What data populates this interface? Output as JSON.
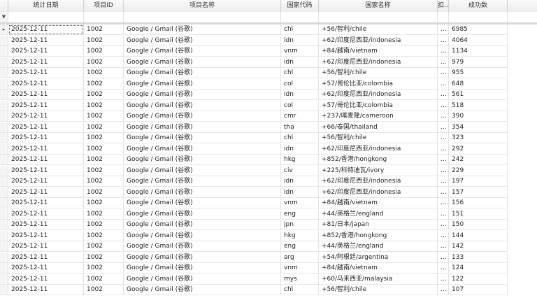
{
  "columns": [
    "统计日期",
    "项目ID",
    "项目名称",
    "国家代码",
    "国家名称",
    "扣…",
    "成功数"
  ],
  "filter_icon": "▼",
  "current_row_icon": "▸",
  "rows": [
    {
      "date": "2025-12-11",
      "pid": "1002",
      "pname": "Google / Gmail (谷歌)",
      "code": "chl",
      "country": "+56/智利/chile",
      "x": "...",
      "count": "6985"
    },
    {
      "date": "2025-12-11",
      "pid": "1002",
      "pname": "Google / Gmail (谷歌)",
      "code": "idn",
      "country": "+62/印度尼西亚/indonesia",
      "x": "...",
      "count": "4064"
    },
    {
      "date": "2025-12-11",
      "pid": "1002",
      "pname": "Google / Gmail (谷歌)",
      "code": "vnm",
      "country": "+84/越南/vietnam",
      "x": "...",
      "count": "1134"
    },
    {
      "date": "2025-12-11",
      "pid": "1002",
      "pname": "Google / Gmail (谷歌)",
      "code": "idn",
      "country": "+62/印度尼西亚/indonesia",
      "x": "...",
      "count": "979"
    },
    {
      "date": "2025-12-11",
      "pid": "1002",
      "pname": "Google / Gmail (谷歌)",
      "code": "chl",
      "country": "+56/智利/chile",
      "x": "...",
      "count": "955"
    },
    {
      "date": "2025-12-11",
      "pid": "1002",
      "pname": "Google / Gmail (谷歌)",
      "code": "col",
      "country": "+57/哥伦比亚/colombia",
      "x": "...",
      "count": "648"
    },
    {
      "date": "2025-12-11",
      "pid": "1002",
      "pname": "Google / Gmail (谷歌)",
      "code": "idn",
      "country": "+62/印度尼西亚/indonesia",
      "x": "...",
      "count": "561"
    },
    {
      "date": "2025-12-11",
      "pid": "1002",
      "pname": "Google / Gmail (谷歌)",
      "code": "col",
      "country": "+57/哥伦比亚/colombia",
      "x": "...",
      "count": "518"
    },
    {
      "date": "2025-12-11",
      "pid": "1002",
      "pname": "Google / Gmail (谷歌)",
      "code": "cmr",
      "country": "+237/喀麦隆/cameroon",
      "x": "...",
      "count": "390"
    },
    {
      "date": "2025-12-11",
      "pid": "1002",
      "pname": "Google / Gmail (谷歌)",
      "code": "tha",
      "country": "+66/泰国/thailand",
      "x": "...",
      "count": "354"
    },
    {
      "date": "2025-12-11",
      "pid": "1002",
      "pname": "Google / Gmail (谷歌)",
      "code": "chl",
      "country": "+56/智利/chile",
      "x": "...",
      "count": "323"
    },
    {
      "date": "2025-12-11",
      "pid": "1002",
      "pname": "Google / Gmail (谷歌)",
      "code": "idn",
      "country": "+62/印度尼西亚/indonesia",
      "x": "...",
      "count": "292"
    },
    {
      "date": "2025-12-11",
      "pid": "1002",
      "pname": "Google / Gmail (谷歌)",
      "code": "hkg",
      "country": "+852/香港/hongkong",
      "x": "...",
      "count": "242"
    },
    {
      "date": "2025-12-11",
      "pid": "1002",
      "pname": "Google / Gmail (谷歌)",
      "code": "civ",
      "country": "+225/科特迪瓦/ivory",
      "x": "...",
      "count": "229"
    },
    {
      "date": "2025-12-11",
      "pid": "1002",
      "pname": "Google / Gmail (谷歌)",
      "code": "idn",
      "country": "+62/印度尼西亚/indonesia",
      "x": "...",
      "count": "197"
    },
    {
      "date": "2025-12-11",
      "pid": "1002",
      "pname": "Google / Gmail (谷歌)",
      "code": "idn",
      "country": "+62/印度尼西亚/indonesia",
      "x": "...",
      "count": "157"
    },
    {
      "date": "2025-12-11",
      "pid": "1002",
      "pname": "Google / Gmail (谷歌)",
      "code": "vnm",
      "country": "+84/越南/vietnam",
      "x": "...",
      "count": "156"
    },
    {
      "date": "2025-12-11",
      "pid": "1002",
      "pname": "Google / Gmail (谷歌)",
      "code": "eng",
      "country": "+44/英格兰/england",
      "x": "...",
      "count": "151"
    },
    {
      "date": "2025-12-11",
      "pid": "1002",
      "pname": "Google / Gmail (谷歌)",
      "code": "jpn",
      "country": "+81/日本/japan",
      "x": "...",
      "count": "150"
    },
    {
      "date": "2025-12-11",
      "pid": "1002",
      "pname": "Google / Gmail (谷歌)",
      "code": "hkg",
      "country": "+852/香港/hongkong",
      "x": "...",
      "count": "144"
    },
    {
      "date": "2025-12-11",
      "pid": "1002",
      "pname": "Google / Gmail (谷歌)",
      "code": "eng",
      "country": "+44/英格兰/england",
      "x": "...",
      "count": "142"
    },
    {
      "date": "2025-12-11",
      "pid": "1002",
      "pname": "Google / Gmail (谷歌)",
      "code": "arg",
      "country": "+54/阿根廷/argentina",
      "x": "...",
      "count": "133"
    },
    {
      "date": "2025-12-11",
      "pid": "1002",
      "pname": "Google / Gmail (谷歌)",
      "code": "vnm",
      "country": "+84/越南/vietnam",
      "x": "...",
      "count": "124"
    },
    {
      "date": "2025-12-11",
      "pid": "1002",
      "pname": "Google / Gmail (谷歌)",
      "code": "mys",
      "country": "+60/马来西亚/malaysia",
      "x": "...",
      "count": "122"
    },
    {
      "date": "2025-12-11",
      "pid": "1002",
      "pname": "Google / Gmail (谷歌)",
      "code": "chl",
      "country": "+56/智利/chile",
      "x": "...",
      "count": "107"
    }
  ]
}
